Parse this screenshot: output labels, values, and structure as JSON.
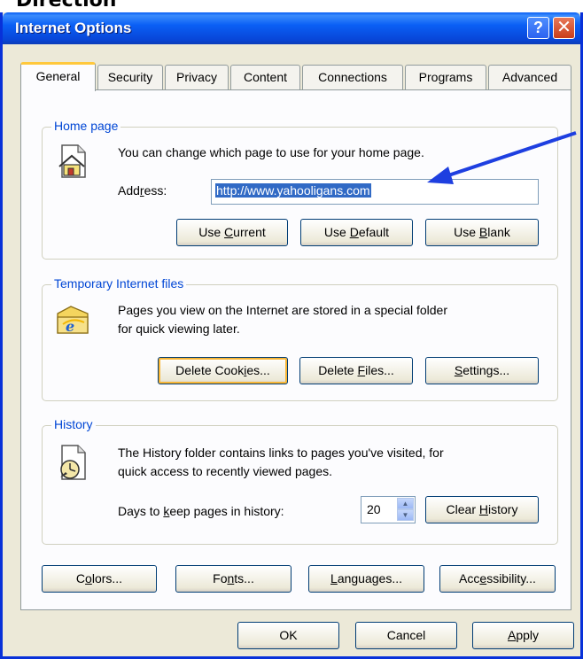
{
  "doc_heading": "Direction",
  "window": {
    "title": "Internet Options",
    "help_glyph": "?",
    "close_glyph": "✕"
  },
  "tabs": [
    {
      "label": "General",
      "active": true
    },
    {
      "label": "Security"
    },
    {
      "label": "Privacy"
    },
    {
      "label": "Content"
    },
    {
      "label": "Connections"
    },
    {
      "label": "Programs"
    },
    {
      "label": "Advanced"
    }
  ],
  "home_page": {
    "legend": "Home page",
    "description": "You can change which page to use for your home page.",
    "address_label_pre": "Add",
    "address_label_key": "r",
    "address_label_post": "ess:",
    "address_value": "http://www.yahooligans.com",
    "use_current": {
      "pre": "Use ",
      "key": "C",
      "post": "urrent"
    },
    "use_default": {
      "pre": "Use ",
      "key": "D",
      "post": "efault"
    },
    "use_blank": {
      "pre": "Use ",
      "key": "B",
      "post": "lank"
    }
  },
  "temp_files": {
    "legend": "Temporary Internet files",
    "line1": "Pages you view on the Internet are stored in a special folder",
    "line2": "for quick viewing later.",
    "delete_cookies": {
      "pre": "Delete Cook",
      "key": "i",
      "post": "es..."
    },
    "delete_files": {
      "pre": "Delete ",
      "key": "F",
      "post": "iles..."
    },
    "settings": {
      "pre": "",
      "key": "S",
      "post": "ettings..."
    }
  },
  "history": {
    "legend": "History",
    "line1": "The History folder contains links to pages you've visited, for",
    "line2": "quick access to recently viewed pages.",
    "days_label_pre": "Days to ",
    "days_label_key": "k",
    "days_label_post": "eep pages in history:",
    "days_value": "20",
    "clear_history": {
      "pre": "Clear ",
      "key": "H",
      "post": "istory"
    }
  },
  "bottom_buttons": {
    "colors": {
      "pre": "C",
      "key": "o",
      "post": "lors..."
    },
    "fonts": {
      "pre": "Fo",
      "key": "n",
      "post": "ts..."
    },
    "languages": {
      "pre": "",
      "key": "L",
      "post": "anguages..."
    },
    "accessibility": {
      "pre": "Acc",
      "key": "e",
      "post": "ssibility..."
    }
  },
  "dialog_buttons": {
    "ok": "OK",
    "cancel": "Cancel",
    "apply": {
      "pre": "",
      "key": "A",
      "post": "pply"
    }
  },
  "colors": {
    "titlebar": "#0a5ff5",
    "legend_text": "#0046d5",
    "selection": "#316ac5",
    "annotation_arrow": "#1e3fe0",
    "tab_highlight": "#ffc83c"
  },
  "icons": [
    "house-page-icon",
    "ie-folder-icon",
    "history-clock-icon",
    "help-icon",
    "close-icon",
    "pointer-arrow-annotation"
  ]
}
